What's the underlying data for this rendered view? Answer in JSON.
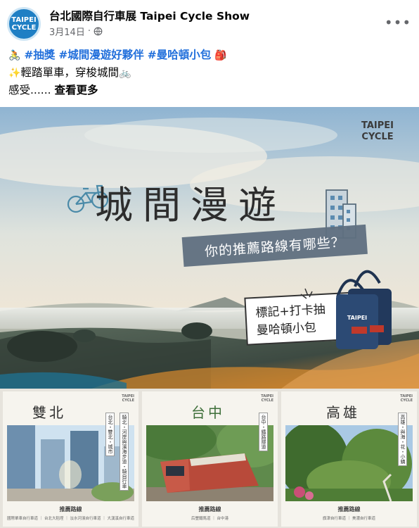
{
  "post": {
    "page_name": "台北國際自行車展 Taipei Cycle Show",
    "avatar_text_1": "TAIPEI",
    "avatar_text_2": "CYCLE",
    "date": "3月14日",
    "separator": "·",
    "privacy_icon": "globe-icon",
    "more_icon": "more-options-icon",
    "more_label": "•••"
  },
  "text": {
    "line1_emoji_start": "🚴",
    "hashtag1": "#抽獎",
    "hashtag2": "#城間漫遊好夥伴",
    "hashtag3": "#曼哈頓小包",
    "line1_emoji_end": "🎒",
    "line2_emoji_start": "✨",
    "line2_text": "輕踏單車，穿梭城間",
    "line2_emoji_end": "🚲",
    "line3_text": "感受......",
    "see_more": "查看更多"
  },
  "hero": {
    "brand_line1": "TAIPEI",
    "brand_line2": "CYCLE",
    "title": "城間漫遊",
    "subtitle": "你的推薦路線有哪些？",
    "promo_line1": "標記+打卡抽",
    "promo_line2": "曼哈頓小包",
    "bag_label": "TAIPEI"
  },
  "thumbs": [
    {
      "title": "雙北",
      "label_a": "台北・雙北・城市",
      "label_b": "騎北・河岸與濱海步道・騎自行車",
      "caption": "推薦路線",
      "sub": "國際單車自行車道 ｜ 台北大稻埕 ｜ 淡水河濱自行車道 ｜ 大漢溪自行車道",
      "logo_line1": "TAIPEI",
      "logo_line2": "CYCLE"
    },
    {
      "title": "台中",
      "label_a": "台中・鐵路隧道",
      "caption": "推薦路線",
      "sub": "后豐鐵馬道 ｜ 台中港",
      "logo_line1": "TAIPEI",
      "logo_line2": "CYCLE"
    },
    {
      "title": "高雄",
      "label_a": "高雄・與海・花・小鎮",
      "caption": "推薦路線",
      "sub": "旗津自行車道 ｜ 美濃自行車道",
      "logo_line1": "TAIPEI",
      "logo_line2": "CYCLE"
    }
  ],
  "colors": {
    "hashtag": "#216fdb",
    "secondary_text": "#65676b",
    "avatar_bg": "#1f7fc4"
  }
}
